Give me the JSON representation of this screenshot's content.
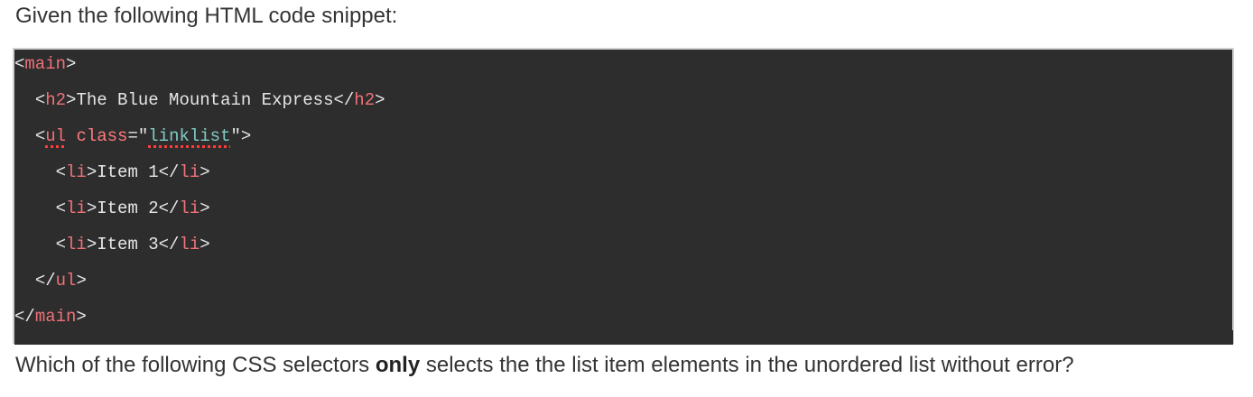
{
  "intro_text": "Given the following HTML code snippet:",
  "code": {
    "line1": {
      "open": "<",
      "tag": "main",
      "close": ">"
    },
    "line2": {
      "indent": "  ",
      "open1": "<",
      "tag1": "h2",
      "close1": ">",
      "text": "The Blue Mountain Express",
      "open2": "</",
      "tag2": "h2",
      "close2": ">"
    },
    "line3": {
      "indent": "  ",
      "open": "<",
      "tag": "ul",
      "space": " ",
      "attr": "class",
      "eq": "=\"",
      "value": "linklist",
      "end": "\">"
    },
    "line4": {
      "indent": "    ",
      "open1": "<",
      "tag1": "li",
      "close1": ">",
      "text": "Item 1",
      "open2": "</",
      "tag2": "li",
      "close2": ">"
    },
    "line5": {
      "indent": "    ",
      "open1": "<",
      "tag1": "li",
      "close1": ">",
      "text": "Item 2",
      "open2": "</",
      "tag2": "li",
      "close2": ">"
    },
    "line6": {
      "indent": "    ",
      "open1": "<",
      "tag1": "li",
      "close1": ">",
      "text": "Item 3",
      "open2": "</",
      "tag2": "li",
      "close2": ">"
    },
    "line7": {
      "indent": "  ",
      "open": "</",
      "tag": "ul",
      "close": ">"
    },
    "line8": {
      "open": "</",
      "tag": "main",
      "close": ">"
    }
  },
  "question": {
    "before": "Which of the following CSS selectors ",
    "emphasis": "only",
    "after": " selects the the list item elements in the unordered list without error?"
  },
  "colors": {
    "code_background": "#2d2d2d",
    "tag": "#f07178",
    "attribute_value": "#80cbc4",
    "code_text": "#e6e6e6",
    "spellcheck_underline": "#ff3b3b"
  }
}
